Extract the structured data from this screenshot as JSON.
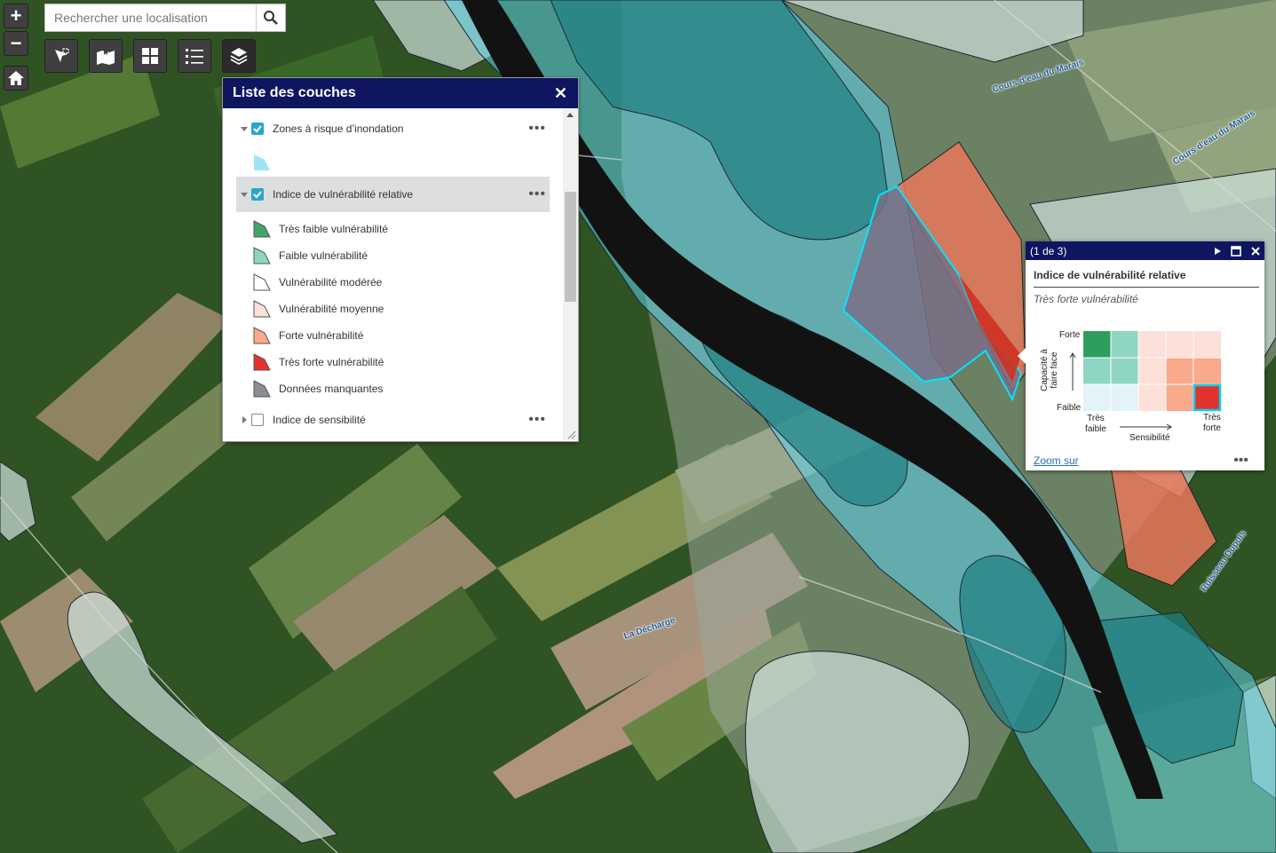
{
  "colors": {
    "header_bg": "#0f1660",
    "accent": "#2aa7c8",
    "flood_zone": "#5ccfea",
    "very_low": "#3fa66b",
    "low": "#8fd6c2",
    "moderate": "#ffffff",
    "medium": "#fde0d8",
    "high": "#f9a98c",
    "very_high": "#e3322e",
    "missing": "#8c8c92"
  },
  "search": {
    "placeholder": "Rechercher une localisation",
    "icon": "search-icon"
  },
  "map_controls": {
    "zoom_in": "+",
    "zoom_out": "−",
    "home_icon": "home-icon",
    "toolbar_icons": [
      "select-tool-icon",
      "bookmark-map-icon",
      "basemap-gallery-icon",
      "legend-list-icon",
      "layers-icon"
    ]
  },
  "layer_list": {
    "title": "Liste des couches",
    "close": "✕",
    "layers": [
      {
        "name": "Zones à risque d’inondation",
        "checked": true,
        "expanded": true
      },
      {
        "name": "Indice de vulnérabilité relative",
        "checked": true,
        "expanded": true
      },
      {
        "name": "Indice de sensibilité",
        "checked": false,
        "expanded": false
      }
    ],
    "legend_items": [
      "Très faible vulnérabilité",
      "Faible vulnérabilité",
      "Vulnérabilité modérée",
      "Vulnérabilité moyenne",
      "Forte vulnérabilité",
      "Très forte vulnérabilité",
      "Données manquantes"
    ],
    "more": "•••"
  },
  "popup": {
    "counter": "(1 de 3)",
    "title": "Indice de vulnérabilité relative",
    "subtitle": "Très forte vulnérabilité",
    "matrix": {
      "y_axis_title": "Capacité à faire face",
      "y_high": "Forte",
      "y_low": "Faible",
      "x_low": "Très faible",
      "x_high": "Très forte",
      "x_axis_title": "Sensibilité",
      "selected": "Très forte vulnérabilité"
    },
    "zoom_link": "Zoom sur",
    "more": "•••"
  },
  "map_labels": [
    "Cours d'eau du Marais",
    "Cours d'eau du Marais",
    "Ruisseau Dupuis",
    "La Décharge"
  ]
}
